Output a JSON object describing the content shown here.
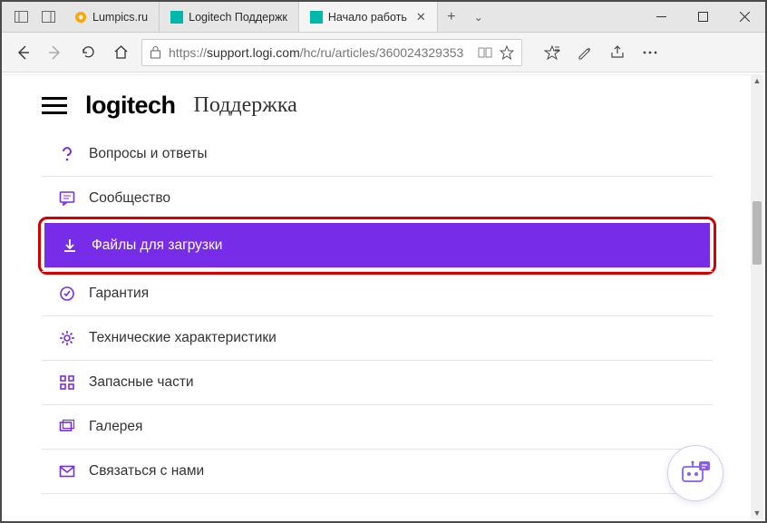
{
  "tabs": [
    {
      "label": "Lumpics.ru"
    },
    {
      "label": "Logitech Поддержк"
    },
    {
      "label": "Начало работь"
    }
  ],
  "url_prefix": "https://",
  "url_host": "support.logi.com",
  "url_path": "/hc/ru/articles/360024329353",
  "brand": "logitech",
  "brand_sub": "Поддержка",
  "menu": {
    "faq": "Вопросы и ответы",
    "community": "Сообщество",
    "downloads": "Файлы для загрузки",
    "warranty": "Гарантия",
    "specs": "Технические характеристики",
    "spare": "Запасные части",
    "gallery": "Галерея",
    "contact": "Связаться с нами"
  }
}
